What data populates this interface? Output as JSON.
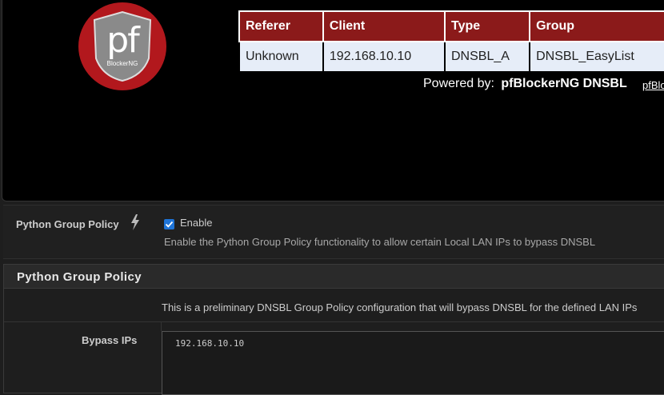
{
  "preview": {
    "logo": {
      "text": "pf",
      "subtext": "BlockerNG",
      "icon": "pfblockerng-logo",
      "color": "#b2181d"
    },
    "table": {
      "headers": [
        "Referer",
        "Client",
        "Type",
        "Group"
      ],
      "row": [
        "Unknown",
        "192.168.10.10",
        "DNSBL_A",
        "DNSBL_EasyList"
      ]
    },
    "powered_prefix": "Powered by:",
    "powered_name": "pfBlockerNG DNSBL",
    "powered_link": "pfBlo"
  },
  "python_policy_row": {
    "label": "Python Group Policy",
    "info_icon": "bolt-icon",
    "checkbox_checked": true,
    "enable_label": "Enable",
    "help": "Enable the Python Group Policy functionality to allow certain Local LAN IPs to bypass DNSBL"
  },
  "panel": {
    "title": "Python Group Policy",
    "info": "This is a preliminary DNSBL Group Policy configuration that will bypass DNSBL for the defined LAN IPs",
    "bypass_label": "Bypass IPs",
    "bypass_value": "192.168.10.10"
  },
  "colors": {
    "header_red": "#8b1a1a",
    "row_bg": "#e6edf8",
    "checkbox_blue": "#1e74d8"
  }
}
